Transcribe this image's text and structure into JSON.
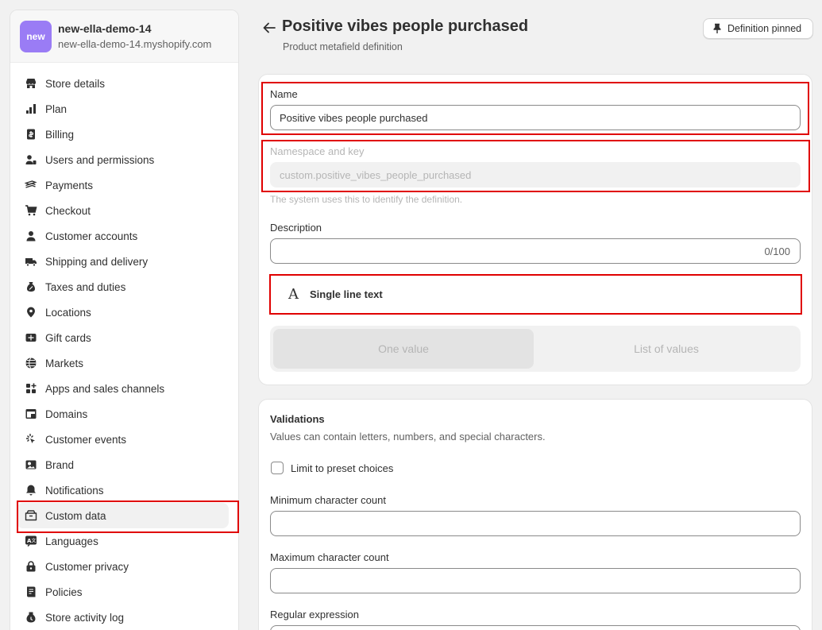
{
  "store": {
    "avatar_text": "new",
    "name": "new-ella-demo-14",
    "domain": "new-ella-demo-14.myshopify.com"
  },
  "sidebar": {
    "items": [
      {
        "label": "Store details",
        "icon": "store-icon"
      },
      {
        "label": "Plan",
        "icon": "plan-icon"
      },
      {
        "label": "Billing",
        "icon": "billing-icon"
      },
      {
        "label": "Users and permissions",
        "icon": "users-icon"
      },
      {
        "label": "Payments",
        "icon": "payments-icon"
      },
      {
        "label": "Checkout",
        "icon": "cart-icon"
      },
      {
        "label": "Customer accounts",
        "icon": "person-icon"
      },
      {
        "label": "Shipping and delivery",
        "icon": "truck-icon"
      },
      {
        "label": "Taxes and duties",
        "icon": "tax-icon"
      },
      {
        "label": "Locations",
        "icon": "location-icon"
      },
      {
        "label": "Gift cards",
        "icon": "gift-card-icon"
      },
      {
        "label": "Markets",
        "icon": "globe-icon"
      },
      {
        "label": "Apps and sales channels",
        "icon": "apps-icon"
      },
      {
        "label": "Domains",
        "icon": "domain-icon"
      },
      {
        "label": "Customer events",
        "icon": "cursor-icon"
      },
      {
        "label": "Brand",
        "icon": "brand-icon"
      },
      {
        "label": "Notifications",
        "icon": "bell-icon"
      },
      {
        "label": "Custom data",
        "icon": "custom-data-icon",
        "active": true
      },
      {
        "label": "Languages",
        "icon": "language-icon"
      },
      {
        "label": "Customer privacy",
        "icon": "lock-icon"
      },
      {
        "label": "Policies",
        "icon": "policy-icon"
      },
      {
        "label": "Store activity log",
        "icon": "activity-icon"
      }
    ]
  },
  "header": {
    "title": "Positive vibes people purchased",
    "subtitle": "Product metafield definition",
    "pin_label": "Definition pinned"
  },
  "definition": {
    "name_label": "Name",
    "name_value": "Positive vibes people purchased",
    "namespace_label": "Namespace and key",
    "namespace_value": "custom.positive_vibes_people_purchased",
    "namespace_help": "The system uses this to identify the definition.",
    "description_label": "Description",
    "description_value": "",
    "description_counter": "0/100",
    "type_icon": "A",
    "type_label": "Single line text",
    "one_value": "One value",
    "list_of_values": "List of values"
  },
  "validations": {
    "title": "Validations",
    "description": "Values can contain letters, numbers, and special characters.",
    "limit_label": "Limit to preset choices",
    "min_label": "Minimum character count",
    "max_label": "Maximum character count",
    "regex_label": "Regular expression"
  },
  "colors": {
    "highlight": "#e00000",
    "avatar": "#9a7cf5"
  }
}
